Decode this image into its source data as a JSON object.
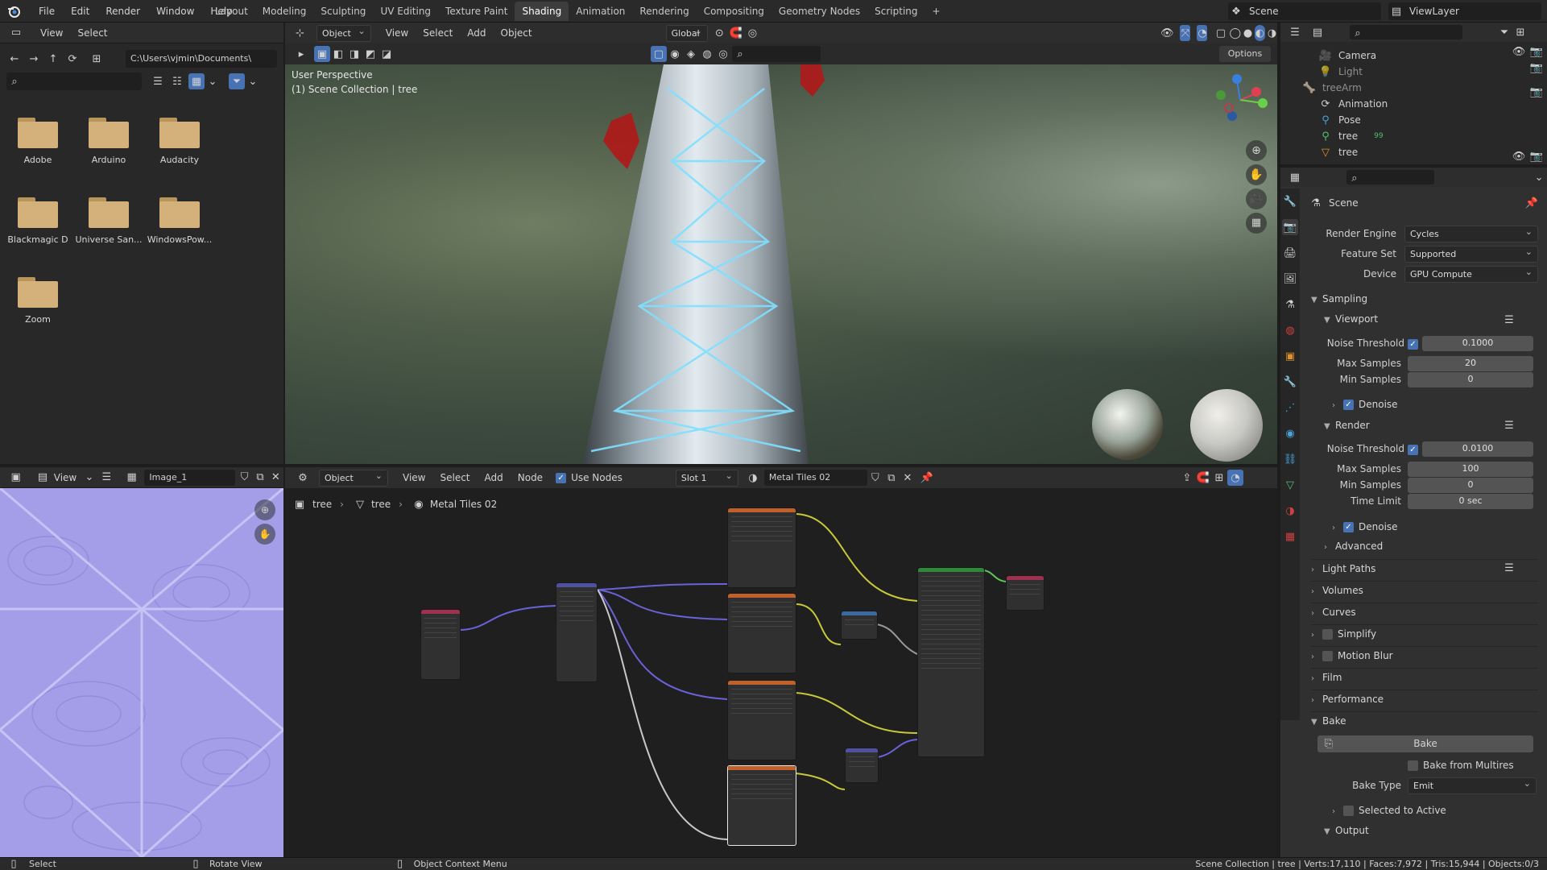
{
  "app": {
    "menu": [
      "File",
      "Edit",
      "Render",
      "Window",
      "Help"
    ],
    "workspaces": [
      "Layout",
      "Modeling",
      "Sculpting",
      "UV Editing",
      "Texture Paint",
      "Shading",
      "Animation",
      "Rendering",
      "Compositing",
      "Geometry Nodes",
      "Scripting"
    ],
    "active_workspace": "Shading",
    "add_tab": "+",
    "scene": "Scene",
    "view_layer": "ViewLayer"
  },
  "file_browser": {
    "view": "View",
    "select": "Select",
    "path": "C:\\Users\\vjmin\\Documents\\",
    "folders": [
      "Adobe",
      "Arduino",
      "Audacity",
      "Blackmagic D",
      "Universe San...",
      "WindowsPow...",
      "Zoom"
    ]
  },
  "viewport": {
    "mode": "Object Mode",
    "menus": [
      "View",
      "Select",
      "Add",
      "Object"
    ],
    "transform": "Global",
    "options": "Options",
    "perspective": "User Perspective",
    "collection": "(1) Scene Collection | tree"
  },
  "image_editor": {
    "view": "View",
    "image": "Image_1"
  },
  "node_editor": {
    "object": "Object",
    "menus": [
      "View",
      "Select",
      "Add",
      "Node"
    ],
    "use_nodes": "Use Nodes",
    "slot": "Slot 1",
    "material": "Metal Tiles 02",
    "breadcrumb": [
      "tree",
      "tree",
      "Metal Tiles 02"
    ]
  },
  "outliner": {
    "items": [
      {
        "name": "Camera",
        "indent": 1
      },
      {
        "name": "Light",
        "indent": 1
      },
      {
        "name": "treeArm",
        "indent": 0
      },
      {
        "name": "Animation",
        "indent": 1
      },
      {
        "name": "Pose",
        "indent": 1
      },
      {
        "name": "tree",
        "indent": 1
      },
      {
        "name": "tree",
        "indent": 1
      }
    ],
    "count": "99"
  },
  "properties": {
    "scene": "Scene",
    "render_engine_label": "Render Engine",
    "render_engine": "Cycles",
    "feature_set_label": "Feature Set",
    "feature_set": "Supported",
    "device_label": "Device",
    "device": "GPU Compute",
    "sampling": "Sampling",
    "viewport": "Viewport",
    "noise_threshold_label": "Noise Threshold",
    "vp_noise": "0.1000",
    "max_samples_label": "Max Samples",
    "vp_max": "20",
    "min_samples_label": "Min Samples",
    "vp_min": "0",
    "denoise": "Denoise",
    "render": "Render",
    "r_noise": "0.0100",
    "r_max": "100",
    "r_min": "0",
    "time_limit_label": "Time Limit",
    "time_limit": "0 sec",
    "advanced": "Advanced",
    "light_paths": "Light Paths",
    "volumes": "Volumes",
    "curves": "Curves",
    "simplify": "Simplify",
    "motion_blur": "Motion Blur",
    "film": "Film",
    "performance": "Performance",
    "bake": "Bake",
    "bake_button": "Bake",
    "bake_multires": "Bake from Multires",
    "bake_type_label": "Bake Type",
    "bake_type": "Emit",
    "selected_to_active": "Selected to Active",
    "output": "Output"
  },
  "status": {
    "select": "Select",
    "rotate": "Rotate View",
    "context": "Object Context Menu",
    "stats": "Scene Collection | tree | Verts:17,110 | Faces:7,972 | Tris:15,944 | Objects:0/3"
  },
  "colors": {
    "accent": "#4772b3",
    "active_tab": "#3d3d3d"
  }
}
